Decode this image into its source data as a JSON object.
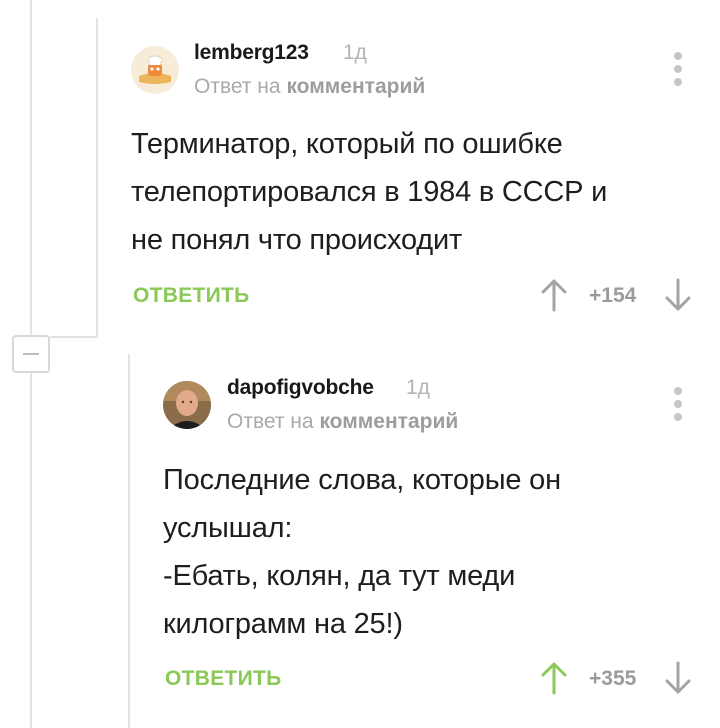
{
  "thread": {
    "collapse_symbol": "−"
  },
  "comments": [
    {
      "author": "lemberg123",
      "time": "1д",
      "reply_prefix": "Ответ на",
      "reply_target": "комментарий",
      "text_lines": [
        "Терминатор, который по ошибке",
        "телепортировался в 1984 в СССР и",
        "не понял что происходит"
      ],
      "reply_label": "ОТВЕТИТЬ",
      "rating": "+154",
      "upvoted": false,
      "colors": {
        "upvote": "#a3a3a3"
      }
    },
    {
      "author": "dapofigvobche",
      "time": "1д",
      "reply_prefix": "Ответ на",
      "reply_target": "комментарий",
      "text_lines": [
        "Последние слова, которые он",
        "услышал:",
        "-Ебать, колян, да тут меди",
        "килограмм на 25!)"
      ],
      "reply_label": "ОТВЕТИТЬ",
      "rating": "+355",
      "upvoted": true,
      "colors": {
        "upvote": "#8ac858"
      }
    }
  ],
  "colors": {
    "accent_green": "#8ac858",
    "muted_gray": "#a3a3a3",
    "thread_line": "#e3e3e3"
  }
}
